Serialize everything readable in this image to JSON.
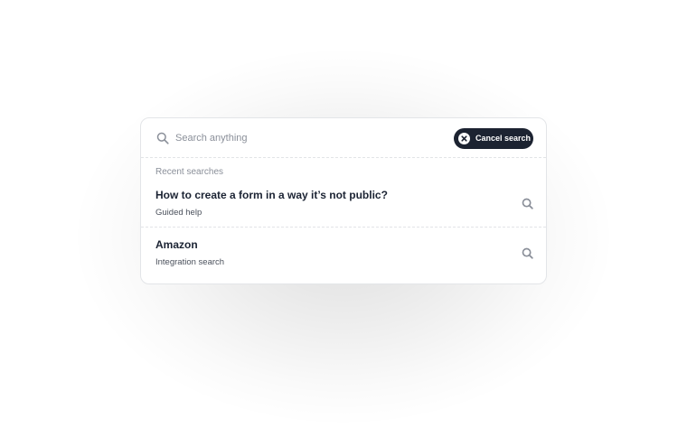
{
  "search": {
    "placeholder": "Search anything",
    "value": "",
    "icon": "search-icon"
  },
  "cancel_button": {
    "label": "Cancel search",
    "icon": "close-circle-icon"
  },
  "recent": {
    "label": "Recent searches",
    "items": [
      {
        "title": "How to create a form in a way it’s not public?",
        "subtitle": "Guided help",
        "icon": "search-icon"
      },
      {
        "title": "Amazon",
        "subtitle": "Integration search",
        "icon": "search-icon"
      }
    ]
  },
  "colors": {
    "button_bg": "#1c2331",
    "text_primary": "#1b2333",
    "text_muted": "#8a8f99"
  }
}
